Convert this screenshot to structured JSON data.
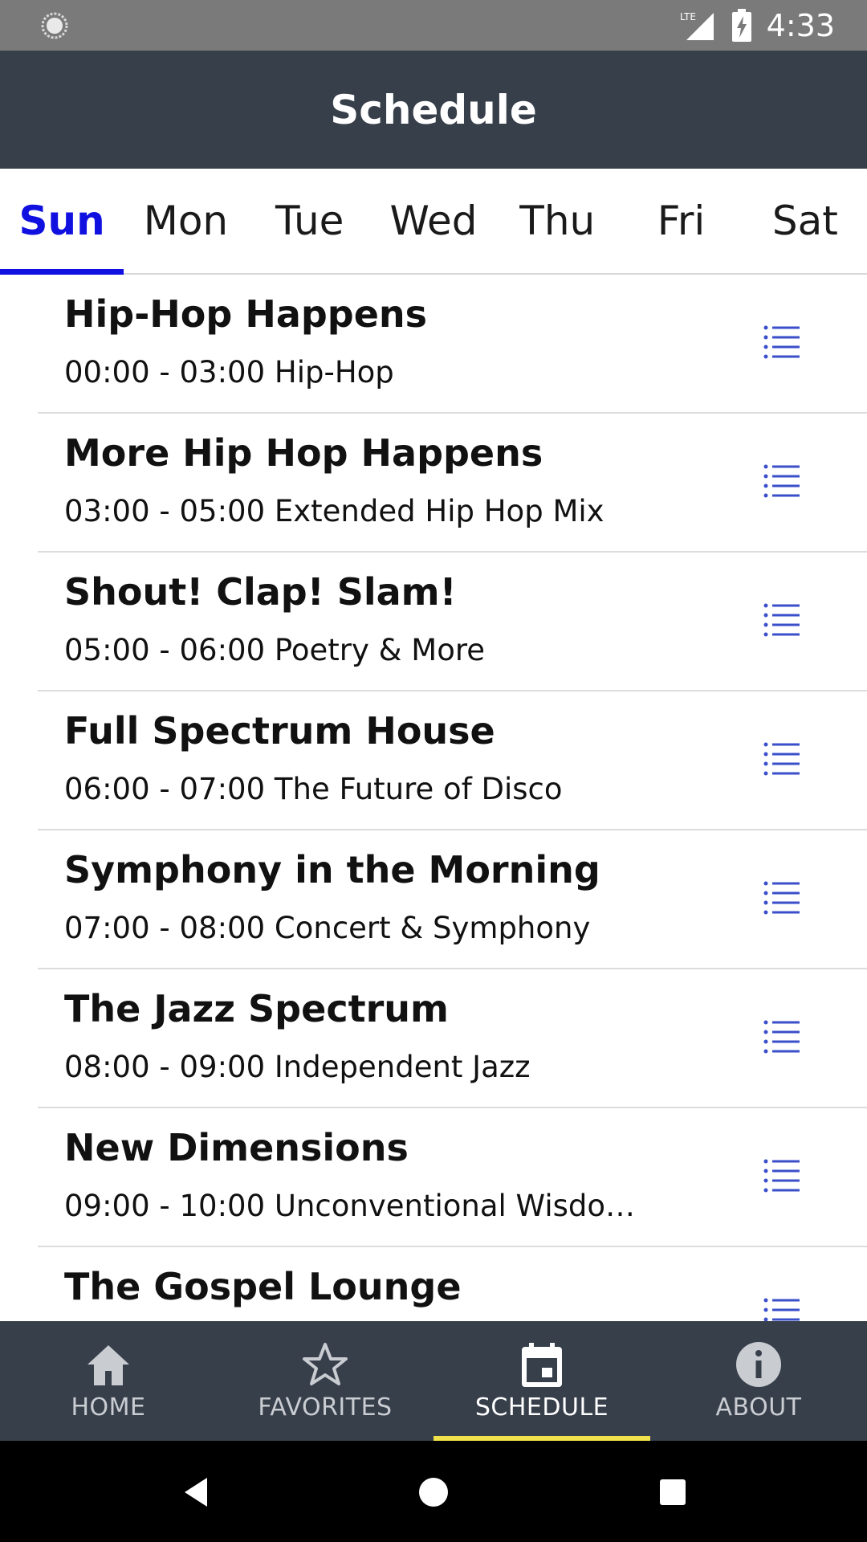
{
  "status_bar": {
    "time": "4:33",
    "network_label": "LTE",
    "icons": [
      "sync-icon",
      "lte-signal-icon",
      "battery-charging-icon"
    ]
  },
  "app_bar": {
    "title": "Schedule"
  },
  "day_tabs": [
    {
      "label": "Sun",
      "active": true
    },
    {
      "label": "Mon",
      "active": false
    },
    {
      "label": "Tue",
      "active": false
    },
    {
      "label": "Wed",
      "active": false
    },
    {
      "label": "Thu",
      "active": false
    },
    {
      "label": "Fri",
      "active": false
    },
    {
      "label": "Sat",
      "active": false
    }
  ],
  "schedule": [
    {
      "title": "Hip-Hop Happens",
      "subtitle": "00:00 - 03:00 Hip-Hop",
      "icon": "list-icon"
    },
    {
      "title": "More Hip Hop Happens",
      "subtitle": "03:00 - 05:00 Extended Hip Hop Mix",
      "icon": "list-icon"
    },
    {
      "title": "Shout! Clap! Slam!",
      "subtitle": "05:00 - 06:00 Poetry & More",
      "icon": "list-icon"
    },
    {
      "title": "Full Spectrum House",
      "subtitle": "06:00 - 07:00 The Future of Disco",
      "icon": "list-icon"
    },
    {
      "title": "Symphony in the Morning",
      "subtitle": "07:00 - 08:00 Concert & Symphony",
      "icon": "list-icon"
    },
    {
      "title": "The Jazz Spectrum",
      "subtitle": "08:00 - 09:00 Independent Jazz",
      "icon": "list-icon"
    },
    {
      "title": "New Dimensions",
      "subtitle": "09:00 - 10:00 Unconventional Wisdo…",
      "icon": "list-icon"
    },
    {
      "title": "The Gospel Lounge",
      "subtitle": "",
      "icon": "list-icon"
    }
  ],
  "bottom_nav": [
    {
      "label": "HOME",
      "icon": "home-icon",
      "active": false
    },
    {
      "label": "FAVORITES",
      "icon": "star-icon",
      "active": false
    },
    {
      "label": "SCHEDULE",
      "icon": "calendar-icon",
      "active": true
    },
    {
      "label": "ABOUT",
      "icon": "info-icon",
      "active": false
    }
  ],
  "system_nav": {
    "icons": [
      "back-icon",
      "home-circle-icon",
      "recents-icon"
    ]
  },
  "colors": {
    "status_bar": "#7a7a7a",
    "app_bar": "#373f4b",
    "active_tab": "#1010e0",
    "list_icon": "#3a4fc9",
    "nav_indicator": "#f1e14a"
  }
}
